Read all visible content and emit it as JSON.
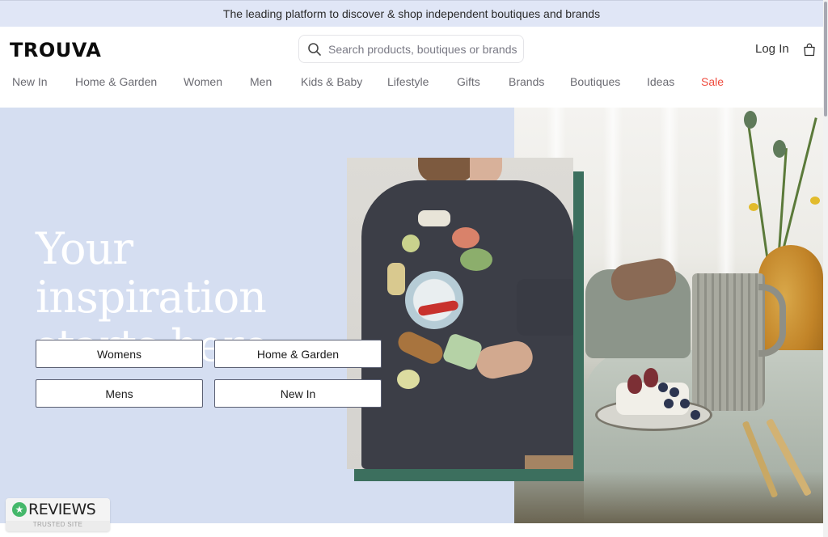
{
  "promo_bar": {
    "text": "The leading platform to discover & shop independent boutiques and brands"
  },
  "header": {
    "logo": "TROUVA",
    "search": {
      "placeholder": "Search products, boutiques or brands",
      "value": "",
      "icon": "search-icon"
    },
    "login_label": "Log In",
    "bag_icon": "shopping-bag-icon"
  },
  "nav": {
    "items": [
      {
        "label": "New In"
      },
      {
        "label": "Home & Garden"
      },
      {
        "label": "Women"
      },
      {
        "label": "Men"
      },
      {
        "label": "Kids & Baby"
      },
      {
        "label": "Lifestyle"
      },
      {
        "label": "Gifts"
      },
      {
        "label": "Brands"
      },
      {
        "label": "Boutiques"
      },
      {
        "label": "Ideas"
      },
      {
        "label": "Sale",
        "highlight": true
      }
    ],
    "sale_color": "#ef4b3e"
  },
  "hero": {
    "headline_line1": "Your inspiration",
    "headline_line2": "starts here",
    "buttons": [
      {
        "label": "Womens"
      },
      {
        "label": "Home & Garden"
      },
      {
        "label": "Mens"
      },
      {
        "label": "New In"
      }
    ],
    "background_color": "#d5def1",
    "frame_color": "#3c6f5e",
    "images": [
      {
        "description": "Model wearing dark long-sleeve top with illustrated dinner-party print"
      },
      {
        "description": "Table setting with ribbed jug, amber vase with flowers, cheese and berries, gold cutlery"
      }
    ]
  },
  "reviews_badge": {
    "title": "REVIEWS",
    "subtitle": "TRUSTED SITE",
    "icon": "star-badge-icon",
    "color": "#45b86b"
  }
}
